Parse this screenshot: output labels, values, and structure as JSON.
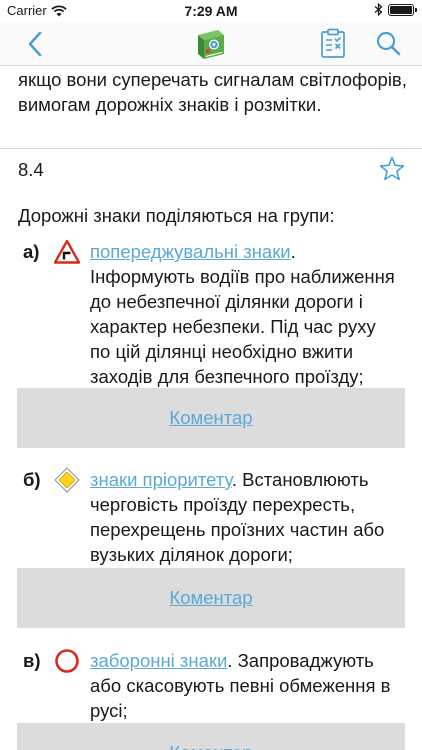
{
  "status_bar": {
    "carrier": "Carrier",
    "time": "7:29 AM",
    "battery_level": 1.0
  },
  "nav_bar": {
    "back_icon": "chevron-left-icon",
    "logo_icon": "book-logo-icon",
    "notes_icon": "clipboard-checklist-icon",
    "search_icon": "search-icon",
    "accent_color": "#4a9fd5"
  },
  "content": {
    "previous_text": "якщо вони суперечать сигналам світлофорів, вимогам дорожніх знаків і розмітки.",
    "section_number": "8.4",
    "intro": "Дорожні знаки поділяються на групи:",
    "items": [
      {
        "label": "а)",
        "icon": "warning-triangle-sign-icon",
        "link": "попереджувальні знаки",
        "text": ". Інформують водіїв про наближення до небезпечної ділянки дороги і характер небезпеки. Під час руху по цій ділянці необхідно вжити заходів для безпечного проїзду;"
      },
      {
        "label": "б)",
        "icon": "priority-diamond-sign-icon",
        "link": "знаки пріоритету",
        "text": ". Встановлюють черговість проїзду перехресть, перехрещень проїзних частин або вузьких ділянок дороги;"
      },
      {
        "label": "в)",
        "icon": "prohibitory-circle-sign-icon",
        "link": "заборонні знаки",
        "text": ". Запроваджують або скасовують певні обмеження в русі;"
      }
    ],
    "comment_label": "Коментар"
  }
}
